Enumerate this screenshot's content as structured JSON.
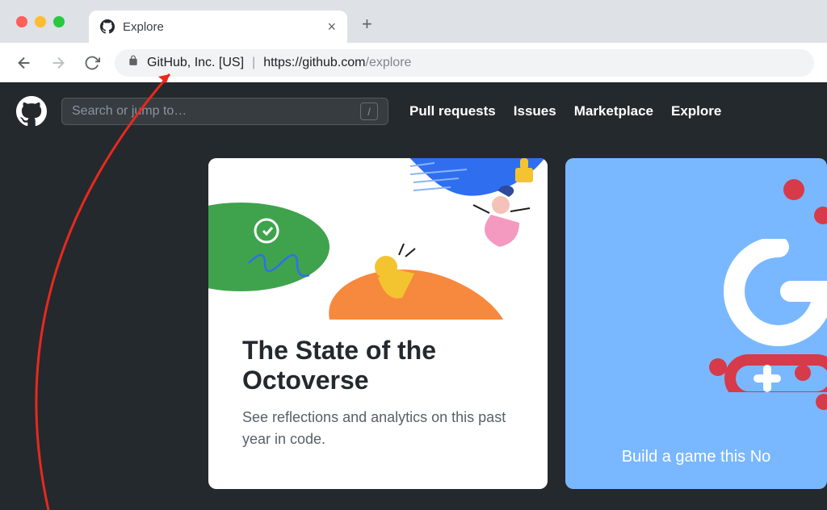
{
  "browser": {
    "tab_title": "Explore",
    "cert_name": "GitHub, Inc. [US]",
    "url_scheme_host": "https://github.com",
    "url_path": "/explore"
  },
  "gh_header": {
    "search_placeholder": "Search or jump to…",
    "slash_key": "/",
    "nav": {
      "pull_requests": "Pull requests",
      "issues": "Issues",
      "marketplace": "Marketplace",
      "explore": "Explore"
    }
  },
  "cards": {
    "octoverse": {
      "title": "The State of the Octoverse",
      "desc": "See reflections and analytics on this past year in code."
    },
    "game": {
      "cta": "Build a game this No"
    }
  }
}
